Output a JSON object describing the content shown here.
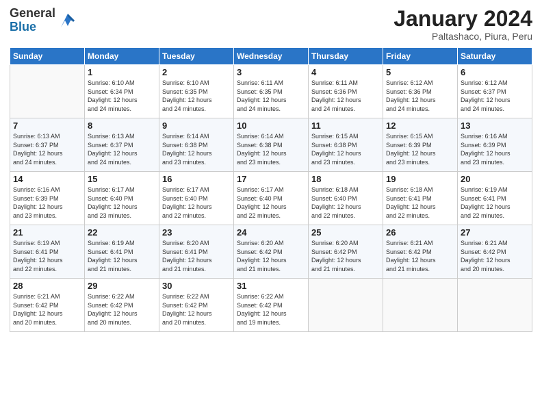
{
  "header": {
    "logo_general": "General",
    "logo_blue": "Blue",
    "month_title": "January 2024",
    "subtitle": "Paltashaco, Piura, Peru"
  },
  "weekdays": [
    "Sunday",
    "Monday",
    "Tuesday",
    "Wednesday",
    "Thursday",
    "Friday",
    "Saturday"
  ],
  "weeks": [
    [
      {
        "day": "",
        "info": ""
      },
      {
        "day": "1",
        "info": "Sunrise: 6:10 AM\nSunset: 6:34 PM\nDaylight: 12 hours\nand 24 minutes."
      },
      {
        "day": "2",
        "info": "Sunrise: 6:10 AM\nSunset: 6:35 PM\nDaylight: 12 hours\nand 24 minutes."
      },
      {
        "day": "3",
        "info": "Sunrise: 6:11 AM\nSunset: 6:35 PM\nDaylight: 12 hours\nand 24 minutes."
      },
      {
        "day": "4",
        "info": "Sunrise: 6:11 AM\nSunset: 6:36 PM\nDaylight: 12 hours\nand 24 minutes."
      },
      {
        "day": "5",
        "info": "Sunrise: 6:12 AM\nSunset: 6:36 PM\nDaylight: 12 hours\nand 24 minutes."
      },
      {
        "day": "6",
        "info": "Sunrise: 6:12 AM\nSunset: 6:37 PM\nDaylight: 12 hours\nand 24 minutes."
      }
    ],
    [
      {
        "day": "7",
        "info": "Sunrise: 6:13 AM\nSunset: 6:37 PM\nDaylight: 12 hours\nand 24 minutes."
      },
      {
        "day": "8",
        "info": "Sunrise: 6:13 AM\nSunset: 6:37 PM\nDaylight: 12 hours\nand 24 minutes."
      },
      {
        "day": "9",
        "info": "Sunrise: 6:14 AM\nSunset: 6:38 PM\nDaylight: 12 hours\nand 23 minutes."
      },
      {
        "day": "10",
        "info": "Sunrise: 6:14 AM\nSunset: 6:38 PM\nDaylight: 12 hours\nand 23 minutes."
      },
      {
        "day": "11",
        "info": "Sunrise: 6:15 AM\nSunset: 6:38 PM\nDaylight: 12 hours\nand 23 minutes."
      },
      {
        "day": "12",
        "info": "Sunrise: 6:15 AM\nSunset: 6:39 PM\nDaylight: 12 hours\nand 23 minutes."
      },
      {
        "day": "13",
        "info": "Sunrise: 6:16 AM\nSunset: 6:39 PM\nDaylight: 12 hours\nand 23 minutes."
      }
    ],
    [
      {
        "day": "14",
        "info": "Sunrise: 6:16 AM\nSunset: 6:39 PM\nDaylight: 12 hours\nand 23 minutes."
      },
      {
        "day": "15",
        "info": "Sunrise: 6:17 AM\nSunset: 6:40 PM\nDaylight: 12 hours\nand 23 minutes."
      },
      {
        "day": "16",
        "info": "Sunrise: 6:17 AM\nSunset: 6:40 PM\nDaylight: 12 hours\nand 22 minutes."
      },
      {
        "day": "17",
        "info": "Sunrise: 6:17 AM\nSunset: 6:40 PM\nDaylight: 12 hours\nand 22 minutes."
      },
      {
        "day": "18",
        "info": "Sunrise: 6:18 AM\nSunset: 6:40 PM\nDaylight: 12 hours\nand 22 minutes."
      },
      {
        "day": "19",
        "info": "Sunrise: 6:18 AM\nSunset: 6:41 PM\nDaylight: 12 hours\nand 22 minutes."
      },
      {
        "day": "20",
        "info": "Sunrise: 6:19 AM\nSunset: 6:41 PM\nDaylight: 12 hours\nand 22 minutes."
      }
    ],
    [
      {
        "day": "21",
        "info": "Sunrise: 6:19 AM\nSunset: 6:41 PM\nDaylight: 12 hours\nand 22 minutes."
      },
      {
        "day": "22",
        "info": "Sunrise: 6:19 AM\nSunset: 6:41 PM\nDaylight: 12 hours\nand 21 minutes."
      },
      {
        "day": "23",
        "info": "Sunrise: 6:20 AM\nSunset: 6:41 PM\nDaylight: 12 hours\nand 21 minutes."
      },
      {
        "day": "24",
        "info": "Sunrise: 6:20 AM\nSunset: 6:42 PM\nDaylight: 12 hours\nand 21 minutes."
      },
      {
        "day": "25",
        "info": "Sunrise: 6:20 AM\nSunset: 6:42 PM\nDaylight: 12 hours\nand 21 minutes."
      },
      {
        "day": "26",
        "info": "Sunrise: 6:21 AM\nSunset: 6:42 PM\nDaylight: 12 hours\nand 21 minutes."
      },
      {
        "day": "27",
        "info": "Sunrise: 6:21 AM\nSunset: 6:42 PM\nDaylight: 12 hours\nand 20 minutes."
      }
    ],
    [
      {
        "day": "28",
        "info": "Sunrise: 6:21 AM\nSunset: 6:42 PM\nDaylight: 12 hours\nand 20 minutes."
      },
      {
        "day": "29",
        "info": "Sunrise: 6:22 AM\nSunset: 6:42 PM\nDaylight: 12 hours\nand 20 minutes."
      },
      {
        "day": "30",
        "info": "Sunrise: 6:22 AM\nSunset: 6:42 PM\nDaylight: 12 hours\nand 20 minutes."
      },
      {
        "day": "31",
        "info": "Sunrise: 6:22 AM\nSunset: 6:42 PM\nDaylight: 12 hours\nand 19 minutes."
      },
      {
        "day": "",
        "info": ""
      },
      {
        "day": "",
        "info": ""
      },
      {
        "day": "",
        "info": ""
      }
    ]
  ]
}
